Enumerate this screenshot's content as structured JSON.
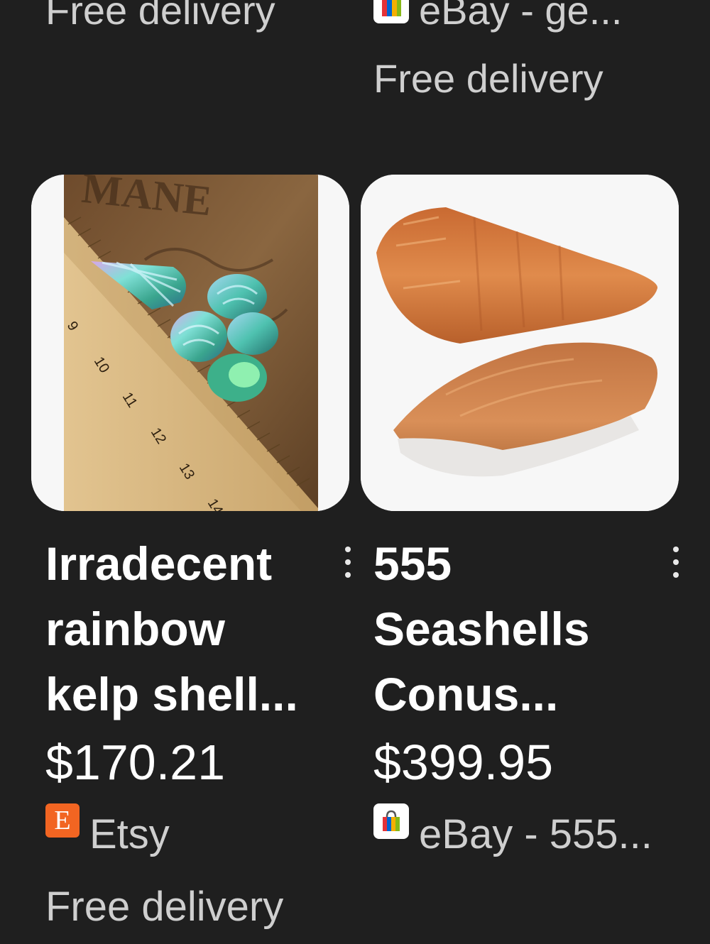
{
  "top_row": {
    "left_delivery": "Free delivery",
    "right_store": "eBay - ge...",
    "right_delivery": "Free delivery"
  },
  "products": [
    {
      "title": "Irradecent rainbow kelp shell...",
      "price": "$170.21",
      "store": "Etsy",
      "store_logo_letter": "E",
      "store_icon": "etsy-logo",
      "delivery": "Free delivery",
      "image": "iridescent-shells-on-ruler",
      "ruler_numbers": [
        "9",
        "10",
        "11",
        "12",
        "13",
        "14"
      ],
      "image_text": "MANE"
    },
    {
      "title": "555 Seashells Conus...",
      "price": "$399.95",
      "store": "eBay - 555...",
      "store_icon": "ebay-shopping-bag-logo",
      "image": "two-cone-shells"
    }
  ],
  "colors": {
    "background": "#1f1f1f",
    "title_text": "#ffffff",
    "secondary_text": "#cfcfcf",
    "etsy_orange": "#f26522"
  }
}
